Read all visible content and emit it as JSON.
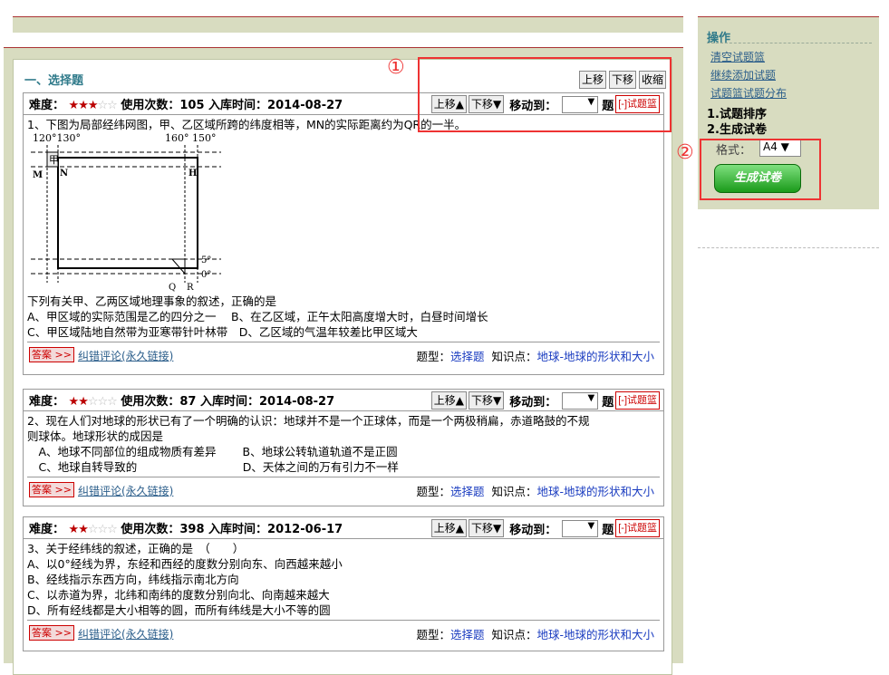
{
  "section_title": "一、选择题",
  "global_tools": [
    "上移",
    "下移",
    "收缩"
  ],
  "questions": [
    {
      "difficulty_label": "难度：",
      "stars_on": "★★★",
      "stars_off": "☆☆",
      "usage_text": "使用次数：105 入库时间：2014-08-27",
      "lines": [
        "1、下图为局部经纬网图，甲、乙区域所跨的纬度相等，MN的实际距离约为QR的一半。",
        "下列有关甲、乙两区域地理事象的叙述，正确的是",
        "A、甲区域的实际范围是乙的四分之一　 B、在乙区域，正午太阳高度增大时，白昼时间增长",
        "C、甲区域陆地自然带为亚寒带针叶林带　D、乙区域的气温年较差比甲区域大"
      ],
      "figure": {
        "lon_left": "120°130°",
        "lon_right": "160° 150°",
        "label_jia": "甲",
        "label_M": "M",
        "label_N": "N",
        "label_H": "H",
        "lat_top": "5°",
        "lat_bottom": "0°",
        "label_Q": "Q",
        "label_R": "R"
      }
    },
    {
      "difficulty_label": "难度：",
      "stars_on": "★★",
      "stars_off": "☆☆☆",
      "usage_text": "使用次数：87 入库时间：2014-08-27",
      "lines": [
        "2、现在人们对地球的形状已有了一个明确的认识：地球并不是一个正球体，而是一个两极稍扁，赤道略鼓的不规",
        "则球体。地球形状的成因是",
        "　A、地球不同部位的组成物质有差异　　 B、地球公转轨道轨道不是正圆",
        "　C、地球自转导致的　　　　　　　　　 D、天体之间的万有引力不一样"
      ]
    },
    {
      "difficulty_label": "难度：",
      "stars_on": "★★",
      "stars_off": "☆☆☆",
      "usage_text": "使用次数：398 入库时间：2012-06-17",
      "lines": [
        "3、关于经纬线的叙述，正确的是　（　　）",
        "A、以0°经线为界，东经和西经的度数分别向东、向西越来越小",
        "B、经线指示东西方向，纬线指示南北方向",
        "C、以赤道为界，北纬和南纬的度数分别向北、向南越来越大",
        "D、所有经线都是大小相等的圆，而所有纬线是大小不等的圆"
      ]
    }
  ],
  "qtools": {
    "up": "上移▲",
    "down": "下移▼",
    "move_to": "移动到：",
    "select_arrow": "▼",
    "ti": "题",
    "basket": "[-]试题篮"
  },
  "footer": {
    "answer": "答案 >>",
    "fix": "纠错评论(永久链接)",
    "type_label": "题型：",
    "type_value": "选择题",
    "kp_label": "知识点：",
    "kp_value": "地球-地球的形状和大小"
  },
  "side": {
    "title": "操作",
    "links": [
      "清空试题篮",
      "继续添加试题",
      "试题篮试题分布"
    ],
    "step1": "1.试题排序",
    "step2": "2.生成试卷",
    "format_label": "格式：",
    "format_value": "A4 ▼",
    "generate": "生成试卷"
  },
  "annotations": [
    "①",
    "②"
  ],
  "colors": {
    "accent": "#2f7a8a",
    "panel": "#d8dcc0",
    "highlight": "#e33",
    "link": "#1a3cc0"
  }
}
